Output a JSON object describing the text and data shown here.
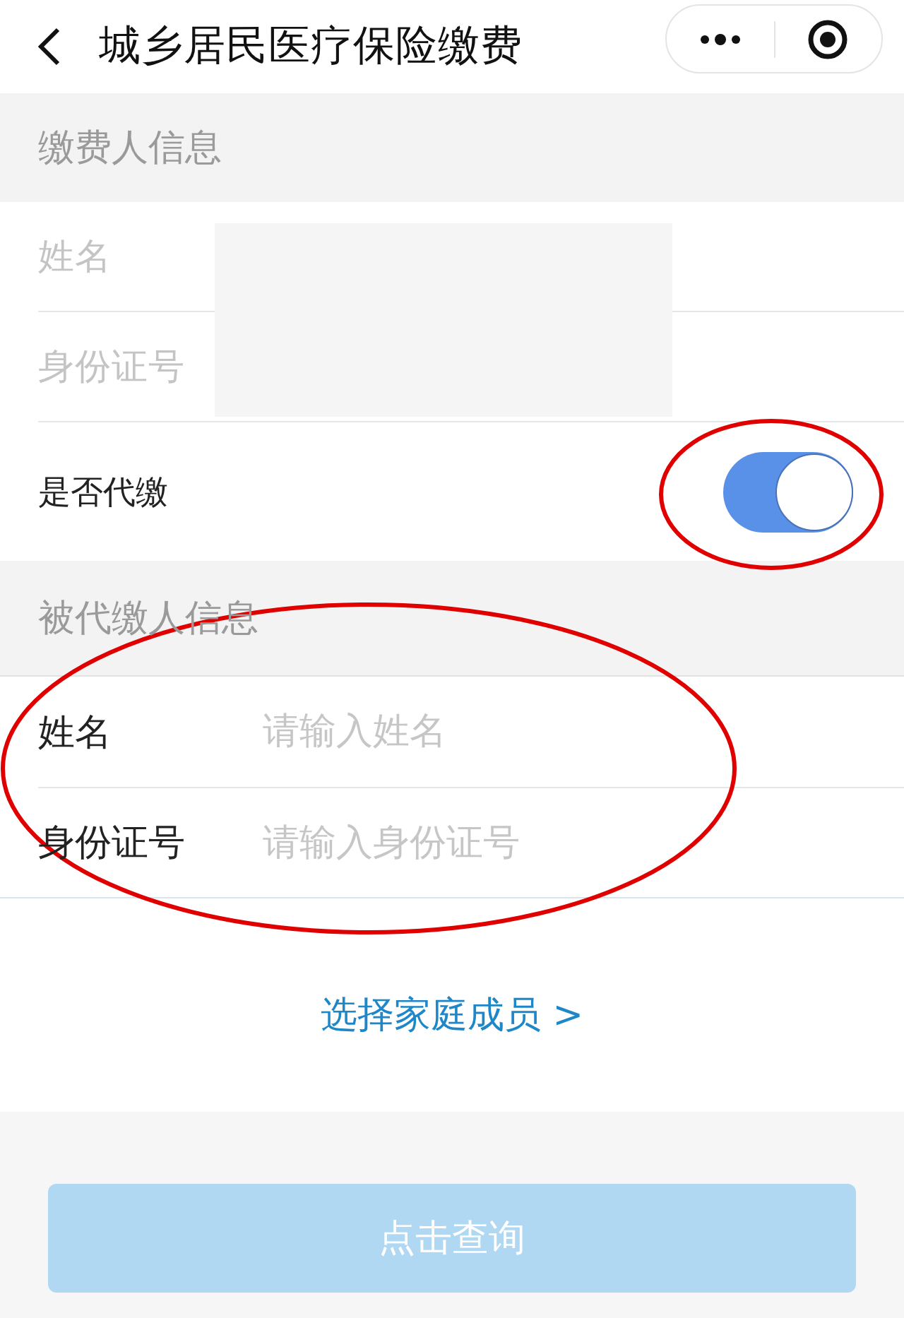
{
  "header": {
    "title": "城乡居民医疗保险缴费"
  },
  "payer_section": {
    "heading": "缴费人信息",
    "values_redacted": true,
    "fields": [
      {
        "label": "姓名",
        "disabled": true
      },
      {
        "label": "身份证号",
        "disabled": true
      }
    ],
    "proxy_toggle": {
      "label": "是否代缴",
      "on": true,
      "circled": true
    }
  },
  "payee_section": {
    "heading": "被代缴人信息",
    "circled": true,
    "fields": [
      {
        "label": "姓名",
        "placeholder": "请输入姓名"
      },
      {
        "label": "身份证号",
        "placeholder": "请输入身份证号"
      }
    ]
  },
  "family_link": "选择家庭成员 >",
  "query_button": {
    "label": "点击查询",
    "disabled": true
  }
}
